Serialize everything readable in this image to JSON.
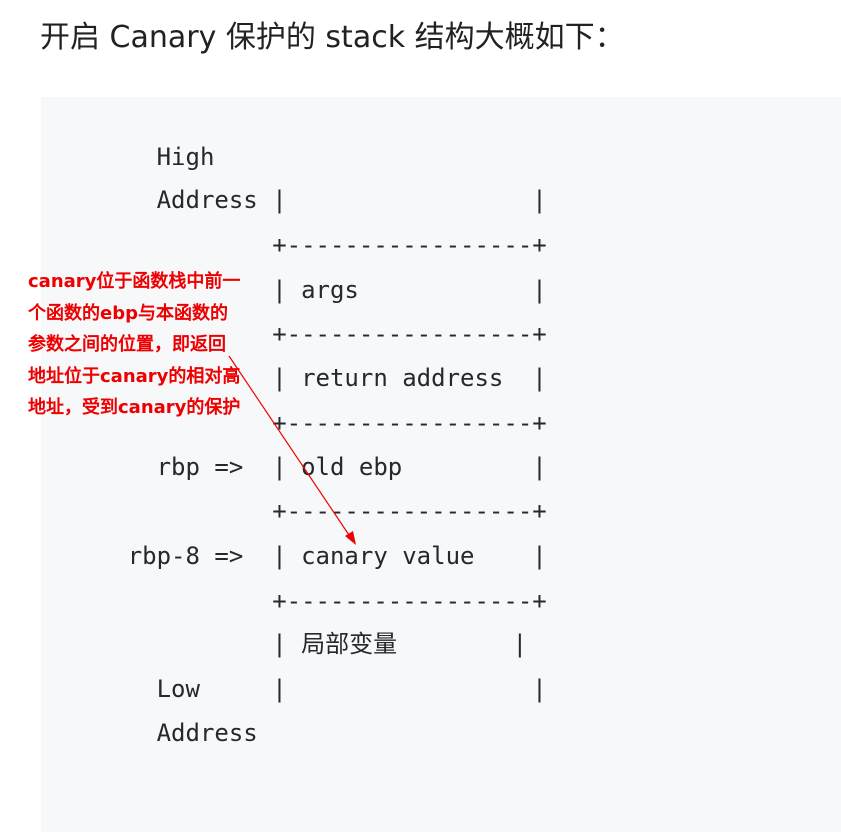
{
  "heading": "开启 Canary 保护的 stack 结构大概如下：",
  "diagram": {
    "lines": [
      "        High",
      "        Address |                 |",
      "                +-----------------+",
      "                | args            |",
      "                +-----------------+",
      "                | return address  |",
      "                +-----------------+",
      "        rbp =>  | old ebp         |",
      "                +-----------------+",
      "      rbp-8 =>  | canary value    |",
      "                +-----------------+",
      "                | 局部变量        |",
      "        Low     |                 |",
      "        Address"
    ]
  },
  "annotation": {
    "text": "canary位于函数栈中前一个函数的ebp与本函数的参数之间的位置，即返回地址位于canary的相对高地址，受到canary的保护",
    "color": "#ee0000"
  }
}
